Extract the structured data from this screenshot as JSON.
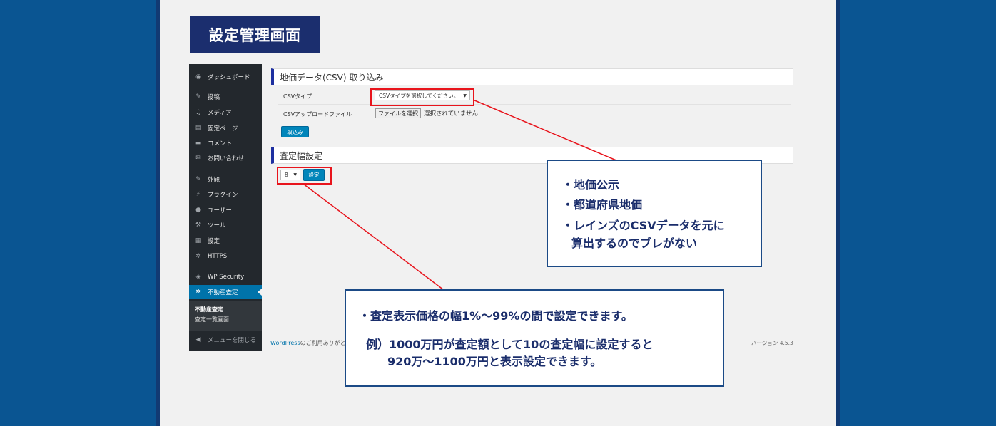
{
  "page_title": "設定管理画面",
  "sidebar": {
    "items": [
      {
        "label": "ダッシュボード",
        "icon": "dashboard-icon",
        "glyph": "◉"
      },
      {
        "label": "投稿",
        "icon": "pin-icon",
        "glyph": "✎"
      },
      {
        "label": "メディア",
        "icon": "media-icon",
        "glyph": "♫"
      },
      {
        "label": "固定ページ",
        "icon": "page-icon",
        "glyph": "▤"
      },
      {
        "label": "コメント",
        "icon": "comment-icon",
        "glyph": "▬"
      },
      {
        "label": "お問い合わせ",
        "icon": "mail-icon",
        "glyph": "✉"
      },
      {
        "label": "外観",
        "icon": "brush-icon",
        "glyph": "✎"
      },
      {
        "label": "プラグイン",
        "icon": "plugin-icon",
        "glyph": "⚡"
      },
      {
        "label": "ユーザー",
        "icon": "user-icon",
        "glyph": "●"
      },
      {
        "label": "ツール",
        "icon": "wrench-icon",
        "glyph": "⚒"
      },
      {
        "label": "設定",
        "icon": "settings-icon",
        "glyph": "▦"
      },
      {
        "label": "HTTPS",
        "icon": "gear-icon",
        "glyph": "✲"
      },
      {
        "label": "WP Security",
        "icon": "shield-icon",
        "glyph": "◈"
      },
      {
        "label": "不動産査定",
        "icon": "gear-icon",
        "glyph": "✲"
      }
    ],
    "submenu": [
      "不動産査定",
      "査定一覧画面"
    ],
    "collapse_label": "メニューを閉じる",
    "collapse_glyph": "◀"
  },
  "csv_section": {
    "heading": "地価データ(CSV) 取り込み",
    "type_label": "CSVタイプ",
    "type_select_value": "CSVタイプを選択してください。",
    "upload_label": "CSVアップロードファイル",
    "file_button": "ファイルを選択",
    "file_status": "選択されていません",
    "import_button": "取込み"
  },
  "range_section": {
    "heading": "査定幅設定",
    "select_value": "8",
    "set_button": "設定"
  },
  "footer": {
    "left_link": "WordPress",
    "left_text": "のご利用ありがと",
    "version": "バージョン 4.5.3"
  },
  "callout_1": {
    "lines": [
      "・地価公示",
      "・都道府県地価",
      "・レインズのCSVデータを元に",
      "算出するのでブレがない"
    ]
  },
  "callout_2": {
    "lines": [
      "・査定表示価格の幅1%～99%の間で設定できます。",
      "例）1000万円が査定額として10の査定幅に設定すると",
      "920万～1100万円と表示設定できます。"
    ]
  },
  "colors": {
    "background": "#0a5592",
    "title_bg": "#1b2e6e",
    "highlight": "#e8141c",
    "callout_border": "#1b4a86",
    "wp_sidebar": "#23282d",
    "wp_primary": "#0085ba"
  }
}
